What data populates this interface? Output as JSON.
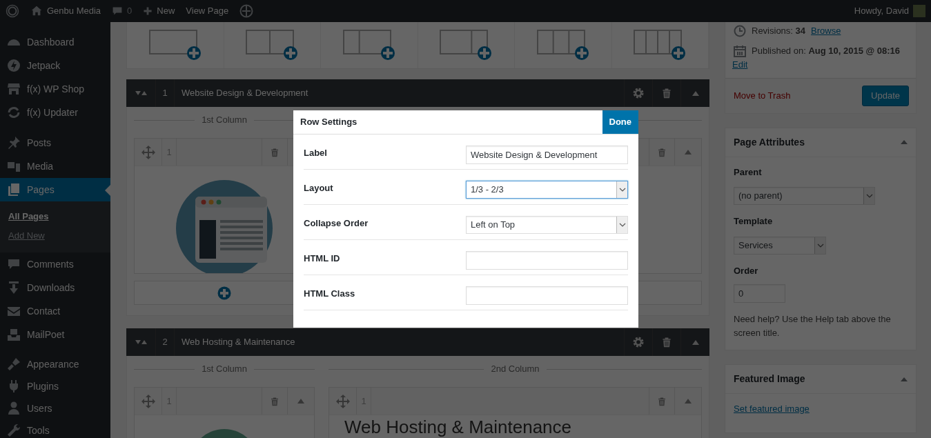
{
  "admin_bar": {
    "site_name": "Genbu Media",
    "comment_count": "0",
    "new_label": "New",
    "view_label": "View Page",
    "greeting": "Howdy, David"
  },
  "menu_groups": [
    [
      {
        "label": "Dashboard",
        "selected": false
      },
      {
        "label": "Jetpack",
        "selected": false
      },
      {
        "label": "f(x) WP Shop",
        "selected": false
      },
      {
        "label": "f(x) Updater",
        "selected": false
      }
    ],
    [
      {
        "label": "Posts",
        "selected": false
      },
      {
        "label": "Media",
        "selected": false
      },
      {
        "label": "Pages",
        "selected": true,
        "children": [
          {
            "label": "All Pages",
            "selected": true
          },
          {
            "label": "Add New",
            "selected": false
          }
        ]
      },
      {
        "label": "Comments",
        "selected": false
      },
      {
        "label": "Downloads",
        "selected": false
      },
      {
        "label": "Contact",
        "selected": false
      },
      {
        "label": "MailPoet",
        "selected": false
      }
    ],
    [
      {
        "label": "Appearance",
        "selected": false
      },
      {
        "label": "Plugins",
        "selected": false
      },
      {
        "label": "Users",
        "selected": false
      },
      {
        "label": "Tools",
        "selected": false
      }
    ]
  ],
  "rows": [
    {
      "number": "1",
      "title": "Website Design & Development",
      "columns": [
        {
          "heading": "1st Column",
          "block_number": "1"
        },
        {}
      ]
    },
    {
      "number": "2",
      "title": "Web Hosting & Maintenance",
      "columns": [
        {
          "heading": "1st Column",
          "block_number": "1"
        },
        {
          "heading": "2nd Column",
          "block_number": "1",
          "content_heading": "Web Hosting & Maintenance"
        }
      ]
    }
  ],
  "modal": {
    "title": "Row Settings",
    "done_button": "Done",
    "fields": [
      {
        "label": "Label",
        "kind": "text",
        "value": "Website Design & Development",
        "focused": false
      },
      {
        "label": "Layout",
        "kind": "select",
        "value": "1/3 - 2/3",
        "focused": true
      },
      {
        "label": "Collapse Order",
        "kind": "select",
        "value": "Left on Top",
        "focused": false
      },
      {
        "label": "HTML ID",
        "kind": "text",
        "focused": false
      },
      {
        "label": "HTML Class",
        "kind": "text",
        "focused": false
      }
    ]
  },
  "publish_box": {
    "revisions": "Revisions: **34**",
    "revisions_link": "Browse",
    "published": "Published on: **Aug 10, 2015 @ 08:16**",
    "edit_link": "Edit",
    "trash_link": "Move to Trash",
    "update_button": "Update"
  },
  "page_attributes": {
    "title": "Page Attributes",
    "parent_label": "Parent",
    "parent_value": "(no parent)",
    "template_label": "Template",
    "template_value": "Services",
    "order_label": "Order",
    "order_value": "0",
    "help_text": "Need help? Use the Help tab above the screen title."
  },
  "featured_image": {
    "title": "Featured Image",
    "link": "Set featured image"
  }
}
